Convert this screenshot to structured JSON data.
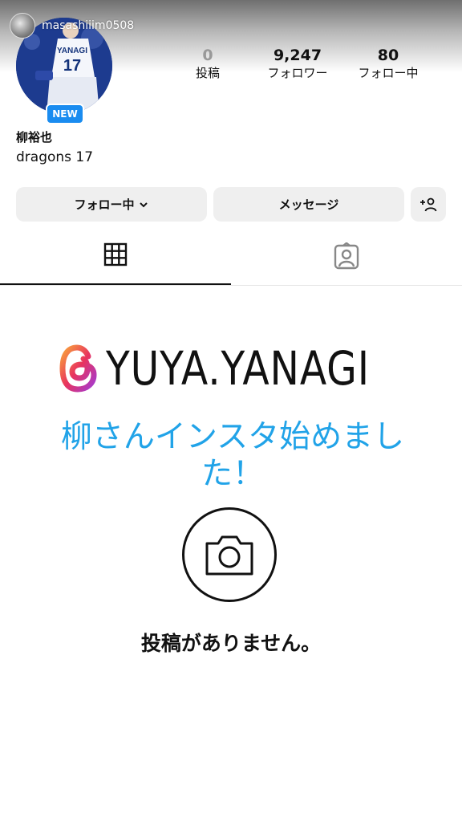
{
  "story": {
    "username": "masashiiim0508"
  },
  "profile": {
    "badge": "NEW",
    "display_name": "柳裕也",
    "bio": "dragons 17",
    "jersey_name": "YANAGI",
    "jersey_number": "17"
  },
  "stats": [
    {
      "value": "0",
      "label": "投稿"
    },
    {
      "value": "9,247",
      "label": "フォロワー"
    },
    {
      "value": "80",
      "label": "フォロー中"
    }
  ],
  "actions": {
    "follow_label": "フォロー中",
    "message_label": "メッセージ"
  },
  "tabs": [
    {
      "icon": "grid-icon",
      "active": true
    },
    {
      "icon": "tagged-icon",
      "active": false
    }
  ],
  "overlay": {
    "threads_handle": "YUYA.YANAGI",
    "announcement_line1": "柳さんインスタ始めまし",
    "announcement_line2": "た！"
  },
  "empty_state": {
    "text": "投稿がありません。"
  },
  "colors": {
    "accent_blue": "#21a3e8",
    "badge_blue": "#1a8cf0",
    "button_bg": "#efefef"
  }
}
